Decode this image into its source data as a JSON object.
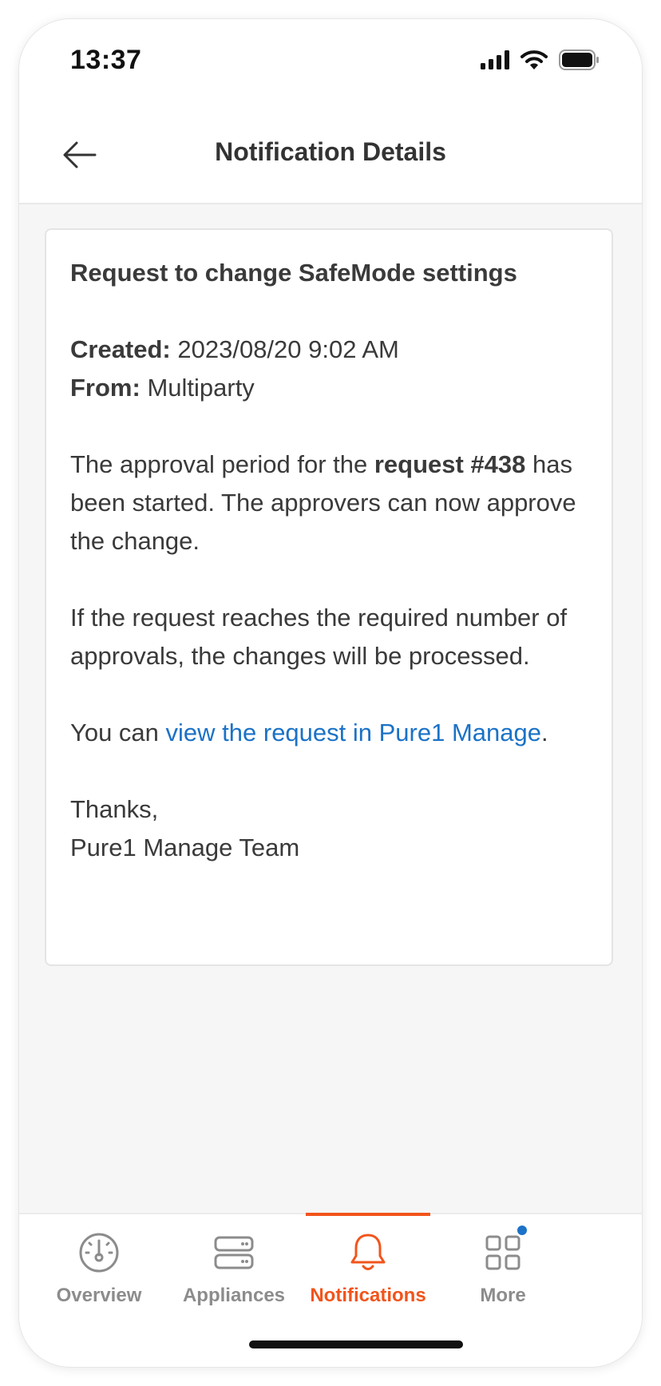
{
  "status_bar": {
    "time": "13:37"
  },
  "header": {
    "title": "Notification Details"
  },
  "notification": {
    "title": "Request to change SafeMode settings",
    "created_label": "Created:",
    "created_value": " 2023/08/20 9:02 AM",
    "from_label": "From:",
    "from_value": " Multiparty",
    "para1_pre": "The approval period for the ",
    "para1_bold": "request #438",
    "para1_post": " has been started. The approvers can now approve the change.",
    "para2": "If the request reaches the required number of approvals, the changes will be processed.",
    "para3_pre": "You can ",
    "para3_link": "view the request in Pure1 Manage",
    "para3_post": ".",
    "signoff": "Thanks,",
    "signature": "Pure1 Manage Team"
  },
  "tabs": [
    {
      "label": "Overview",
      "icon": "gauge-icon",
      "active": false
    },
    {
      "label": "Appliances",
      "icon": "server-icon",
      "active": false
    },
    {
      "label": "Notifications",
      "icon": "bell-icon",
      "active": true
    },
    {
      "label": "More",
      "icon": "grid-icon",
      "active": false,
      "badge": true
    }
  ],
  "colors": {
    "accent": "#f2541b",
    "link": "#1b72c7",
    "inactive_tab": "#8c8c8c"
  }
}
